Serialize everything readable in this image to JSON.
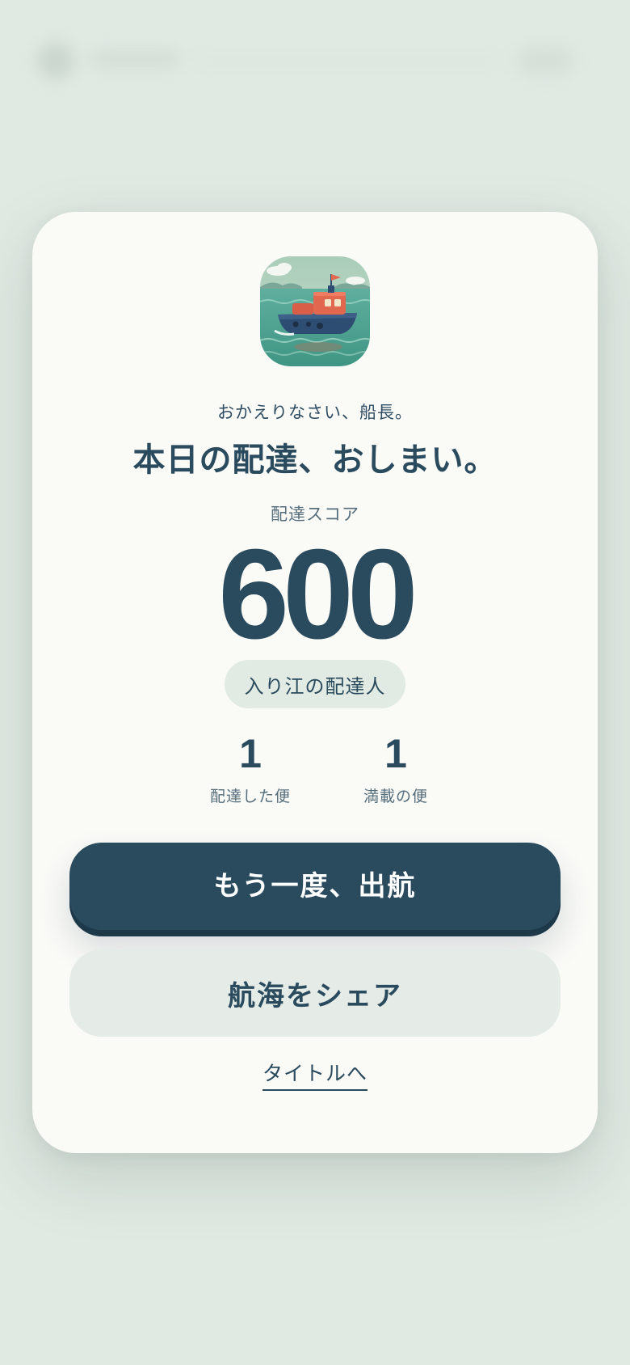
{
  "colors": {
    "background": "#e0e9e2",
    "card": "#fafaf7",
    "primary": "#2a4a5e",
    "secondary_button": "#e5ebe6",
    "badge": "#e2ebe3"
  },
  "result": {
    "icon": "boat-icon",
    "greeting": "おかえりなさい、船長。",
    "headline": "本日の配達、おしまい。",
    "score_label": "配達スコア",
    "score_value": "600",
    "rank_badge": "入り江の配達人",
    "stats": [
      {
        "value": "1",
        "label": "配達した便"
      },
      {
        "value": "1",
        "label": "満載の便"
      }
    ],
    "primary_button": "もう一度、出航",
    "secondary_button": "航海をシェア",
    "title_link": "タイトルへ"
  }
}
